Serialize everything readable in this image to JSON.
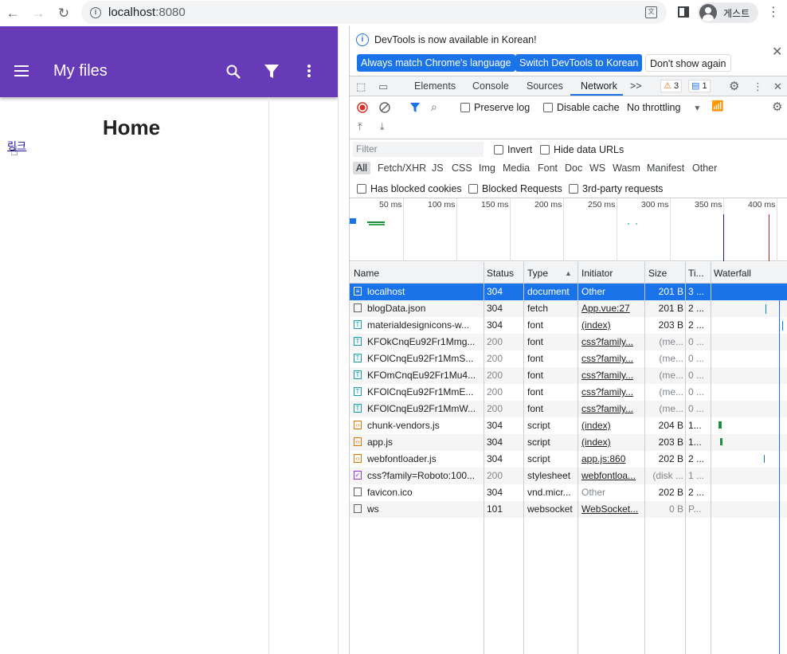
{
  "browser": {
    "url_host": "localhost",
    "url_port": ":8080",
    "profile_name": "게스트"
  },
  "page": {
    "app_title": "My files",
    "heading": "Home",
    "link_text": "링크"
  },
  "devtools": {
    "banner_message": "DevTools is now available in Korean!",
    "btn_match": "Always match Chrome's language",
    "btn_switch": "Switch DevTools to Korean",
    "btn_dont_show": "Don't show again",
    "tabs": [
      "Elements",
      "Console",
      "Sources",
      "Network"
    ],
    "active_tab": "Network",
    "more_tabs": ">>",
    "warn_count": "3",
    "msg_count": "1",
    "preserve_log": "Preserve log",
    "disable_cache": "Disable cache",
    "throttling": "No throttling",
    "filter_placeholder": "Filter",
    "invert": "Invert",
    "hide_data_urls": "Hide data URLs",
    "types": [
      "All",
      "Fetch/XHR",
      "JS",
      "CSS",
      "Img",
      "Media",
      "Font",
      "Doc",
      "WS",
      "Wasm",
      "Manifest",
      "Other"
    ],
    "has_blocked_cookies": "Has blocked cookies",
    "blocked_requests": "Blocked Requests",
    "third_party": "3rd-party requests",
    "timeline_ticks": [
      "50 ms",
      "100 ms",
      "150 ms",
      "200 ms",
      "250 ms",
      "300 ms",
      "350 ms",
      "400 ms"
    ],
    "columns": [
      "Name",
      "Status",
      "Type",
      "Initiator",
      "Size",
      "Ti...",
      "Waterfall"
    ],
    "rows": [
      {
        "name": "localhost",
        "status": "304",
        "type": "document",
        "initiator": "Other",
        "size": "201 B",
        "time": "3 ...",
        "icon": "doc-icon"
      },
      {
        "name": "blogData.json",
        "status": "304",
        "type": "fetch",
        "initiator": "App.vue:27",
        "size": "201 B",
        "time": "2 ...",
        "icon": "fetch-icon"
      },
      {
        "name": "materialdesignicons-w...",
        "status": "304",
        "type": "font",
        "initiator": "(index)",
        "size": "203 B",
        "time": "2 ...",
        "icon": "font-icon"
      },
      {
        "name": "KFOkCnqEu92Fr1Mmg...",
        "status": "200",
        "type": "font",
        "initiator": "css?family...",
        "size": "(me...",
        "time": "0 ...",
        "icon": "font-icon"
      },
      {
        "name": "KFOlCnqEu92Fr1MmS...",
        "status": "200",
        "type": "font",
        "initiator": "css?family...",
        "size": "(me...",
        "time": "0 ...",
        "icon": "font-icon"
      },
      {
        "name": "KFOmCnqEu92Fr1Mu4...",
        "status": "200",
        "type": "font",
        "initiator": "css?family...",
        "size": "(me...",
        "time": "0 ...",
        "icon": "font-icon"
      },
      {
        "name": "KFOlCnqEu92Fr1MmE...",
        "status": "200",
        "type": "font",
        "initiator": "css?family...",
        "size": "(me...",
        "time": "0 ...",
        "icon": "font-icon"
      },
      {
        "name": "KFOlCnqEu92Fr1MmW...",
        "status": "200",
        "type": "font",
        "initiator": "css?family...",
        "size": "(me...",
        "time": "0 ...",
        "icon": "font-icon"
      },
      {
        "name": "chunk-vendors.js",
        "status": "304",
        "type": "script",
        "initiator": "(index)",
        "size": "204 B",
        "time": "1...",
        "icon": "script-icon"
      },
      {
        "name": "app.js",
        "status": "304",
        "type": "script",
        "initiator": "(index)",
        "size": "203 B",
        "time": "1...",
        "icon": "script-icon"
      },
      {
        "name": "webfontloader.js",
        "status": "304",
        "type": "script",
        "initiator": "app.js:860",
        "size": "202 B",
        "time": "2 ...",
        "icon": "script-icon"
      },
      {
        "name": "css?family=Roboto:100...",
        "status": "200",
        "type": "stylesheet",
        "initiator": "webfontloa...",
        "size": "(disk ...",
        "time": "1 ...",
        "icon": "css-icon"
      },
      {
        "name": "favicon.ico",
        "status": "304",
        "type": "vnd.micr...",
        "initiator": "Other",
        "size": "202 B",
        "time": "2 ...",
        "icon": "file-icon"
      },
      {
        "name": "ws",
        "status": "101",
        "type": "websocket",
        "initiator": "WebSocket...",
        "size": "0 B",
        "time": "P...",
        "icon": "file-icon"
      }
    ]
  }
}
